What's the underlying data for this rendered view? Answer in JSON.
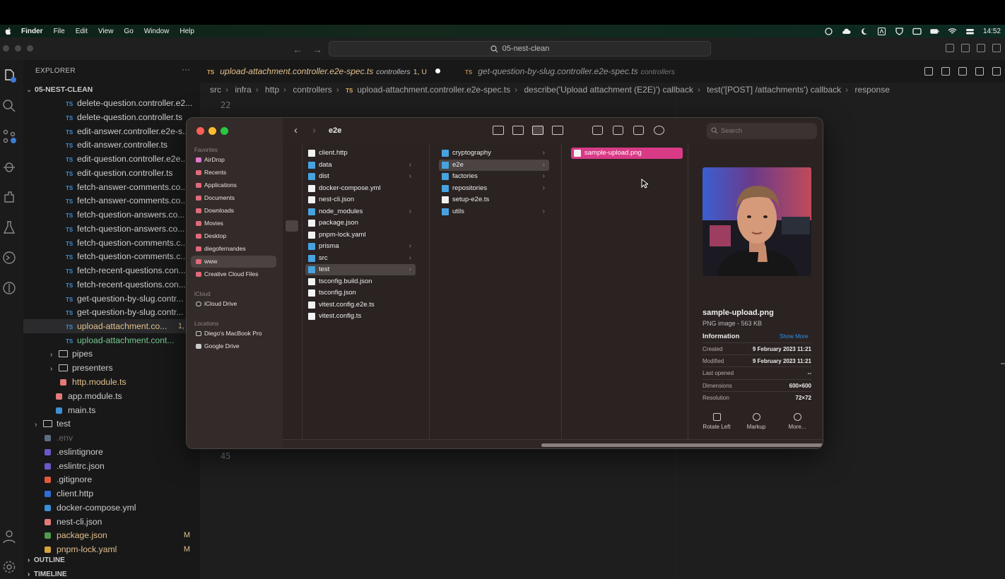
{
  "menubar": {
    "menus": [
      "Finder",
      "File",
      "Edit",
      "View",
      "Go",
      "Window",
      "Help"
    ],
    "clock": "14:52"
  },
  "titlebar": {
    "search": "05-nest-clean"
  },
  "explorer": {
    "title": "EXPLORER",
    "project": "05-NEST-CLEAN",
    "files": [
      {
        "name": "delete-question.controller.e2...",
        "kind": "ts"
      },
      {
        "name": "delete-question.controller.ts",
        "kind": "ts"
      },
      {
        "name": "edit-answer.controller.e2e-s...",
        "kind": "ts"
      },
      {
        "name": "edit-answer.controller.ts",
        "kind": "ts"
      },
      {
        "name": "edit-question.controller.e2e...",
        "kind": "ts"
      },
      {
        "name": "edit-question.controller.ts",
        "kind": "ts"
      },
      {
        "name": "fetch-answer-comments.co...",
        "kind": "ts"
      },
      {
        "name": "fetch-answer-comments.co...",
        "kind": "ts"
      },
      {
        "name": "fetch-question-answers.co...",
        "kind": "ts"
      },
      {
        "name": "fetch-question-answers.co...",
        "kind": "ts"
      },
      {
        "name": "fetch-question-comments.c...",
        "kind": "ts"
      },
      {
        "name": "fetch-question-comments.c...",
        "kind": "ts"
      },
      {
        "name": "fetch-recent-questions.con...",
        "kind": "ts"
      },
      {
        "name": "fetch-recent-questions.con...",
        "kind": "ts"
      },
      {
        "name": "get-question-by-slug.contr...",
        "kind": "ts"
      },
      {
        "name": "get-question-by-slug.contr...",
        "kind": "ts"
      },
      {
        "name": "upload-attachment.co...",
        "kind": "ts",
        "badge": "1,"
      },
      {
        "name": "upload-attachment.cont...",
        "kind": "ts"
      }
    ],
    "folders": [
      "pipes",
      "presenters"
    ],
    "lower": [
      {
        "name": "http.module.ts",
        "badge": ""
      },
      {
        "name": "app.module.ts",
        "badge": ""
      },
      {
        "name": "main.ts",
        "badge": ""
      },
      {
        "name": "test",
        "badge": ""
      },
      {
        "name": ".env",
        "badge": ""
      },
      {
        "name": ".eslintignore",
        "badge": ""
      },
      {
        "name": ".eslintrc.json",
        "badge": ""
      },
      {
        "name": ".gitignore",
        "badge": ""
      },
      {
        "name": "client.http",
        "badge": ""
      },
      {
        "name": "docker-compose.yml",
        "badge": ""
      },
      {
        "name": "nest-cli.json",
        "badge": ""
      },
      {
        "name": "package.json",
        "badge": "M"
      },
      {
        "name": "pnpm-lock.yaml",
        "badge": "M"
      }
    ],
    "outline": "OUTLINE",
    "timeline": "TIMELINE"
  },
  "tabs": [
    {
      "name": "upload-attachment.controller.e2e-spec.ts",
      "dir": "controllers",
      "status": "1, U"
    },
    {
      "name": "get-question-by-slug.controller.e2e-spec.ts",
      "dir": "controllers"
    }
  ],
  "breadcrumbs": [
    "src",
    "infra",
    "http",
    "controllers",
    "upload-attachment.controller.e2e-spec.ts",
    "describe('Upload attachment (E2E)') callback",
    "test('[POST] /attachments') callback",
    "response"
  ],
  "editor": {
    "line_top": "22",
    "line_bottom": "45"
  },
  "finder": {
    "title": "e2e",
    "search_placeholder": "Search",
    "favorites_label": "Favorites",
    "favorites": [
      "AirDrop",
      "Recents",
      "Applications",
      "Documents",
      "Downloads",
      "Movies",
      "Desktop",
      "diegofernandes",
      "www",
      "Creative Cloud Files"
    ],
    "icloud_label": "iCloud",
    "icloud": [
      "iCloud Drive"
    ],
    "locations_label": "Locations",
    "locations": [
      "Diego's MacBook Pro",
      "Google Drive"
    ],
    "col1": [
      {
        "name": "client.http",
        "folder": false
      },
      {
        "name": "data",
        "folder": true
      },
      {
        "name": "dist",
        "folder": true
      },
      {
        "name": "docker-compose.yml",
        "folder": false
      },
      {
        "name": "nest-cli.json",
        "folder": false
      },
      {
        "name": "node_modules",
        "folder": true
      },
      {
        "name": "package.json",
        "folder": false
      },
      {
        "name": "pnpm-lock.yaml",
        "folder": false
      },
      {
        "name": "prisma",
        "folder": true
      },
      {
        "name": "src",
        "folder": true
      },
      {
        "name": "test",
        "folder": true
      },
      {
        "name": "tsconfig.build.json",
        "folder": false
      },
      {
        "name": "tsconfig.json",
        "folder": false
      },
      {
        "name": "vitest.config.e2e.ts",
        "folder": false
      },
      {
        "name": "vitest.config.ts",
        "folder": false
      }
    ],
    "col2": [
      {
        "name": "cryptography",
        "folder": true
      },
      {
        "name": "e2e",
        "folder": true
      },
      {
        "name": "factories",
        "folder": true
      },
      {
        "name": "repositories",
        "folder": true
      },
      {
        "name": "setup-e2e.ts",
        "folder": false
      },
      {
        "name": "utils",
        "folder": true
      }
    ],
    "col3": [
      "sample-upload.png"
    ],
    "preview": {
      "name": "sample-upload.png",
      "type": "PNG image - 563 KB",
      "info_label": "Information",
      "show_more": "Show More",
      "rows": [
        {
          "k": "Created",
          "v": "9 February 2023 11:21"
        },
        {
          "k": "Modified",
          "v": "9 February 2023 11:21"
        },
        {
          "k": "Last opened",
          "v": "--"
        },
        {
          "k": "Dimensions",
          "v": "600×600"
        },
        {
          "k": "Resolution",
          "v": "72×72"
        }
      ],
      "actions": [
        "Rotate Left",
        "Markup",
        "More..."
      ]
    }
  }
}
